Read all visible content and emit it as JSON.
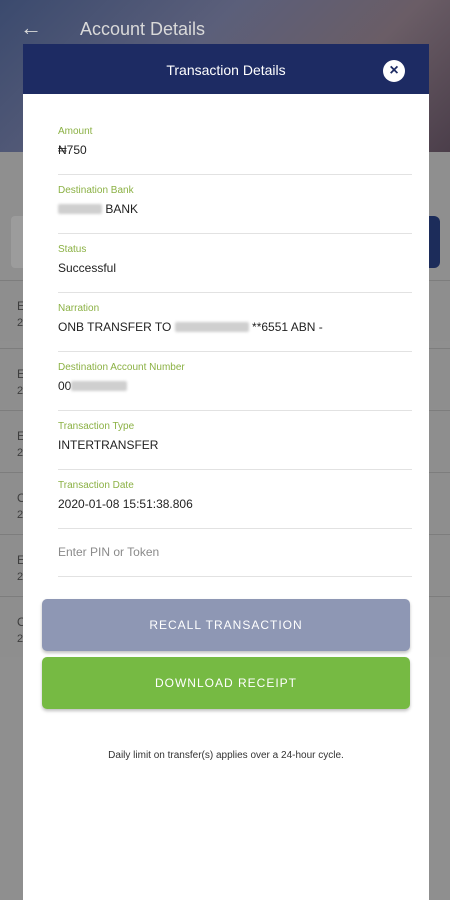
{
  "background": {
    "title": "Account Details",
    "rows": [
      {
        "line1": "E",
        "line2": "2"
      },
      {
        "line1": "E",
        "line2": "2"
      },
      {
        "line1": "E",
        "line2": "2"
      },
      {
        "line1": "O",
        "line2": "2"
      },
      {
        "line1": "E",
        "line2": "2"
      },
      {
        "line1": "O",
        "line2": "2"
      }
    ]
  },
  "modal": {
    "title": "Transaction Details",
    "close_label": "×",
    "fields": {
      "amount": {
        "label": "Amount",
        "value": "₦750"
      },
      "destination_bank": {
        "label": "Destination Bank",
        "value": "BANK"
      },
      "status": {
        "label": "Status",
        "value": "Successful"
      },
      "narration": {
        "label": "Narration",
        "value_prefix": "ONB TRANSFER TO",
        "value_suffix": "**6551 ABN -"
      },
      "destination_account": {
        "label": "Destination Account Number",
        "value_prefix": "00"
      },
      "transaction_type": {
        "label": "Transaction Type",
        "value": "INTERTRANSFER"
      },
      "transaction_date": {
        "label": "Transaction Date",
        "value": "2020-01-08 15:51:38.806"
      }
    },
    "pin_placeholder": "Enter PIN or Token",
    "recall_button": "RECALL TRANSACTION",
    "download_button": "DOWNLOAD RECEIPT",
    "note": "Daily limit on transfer(s) applies over a 24-hour cycle."
  },
  "colors": {
    "header": "#1d2b63",
    "label_green": "#8bb144",
    "recall": "#8e97b4",
    "download": "#76ba43"
  }
}
